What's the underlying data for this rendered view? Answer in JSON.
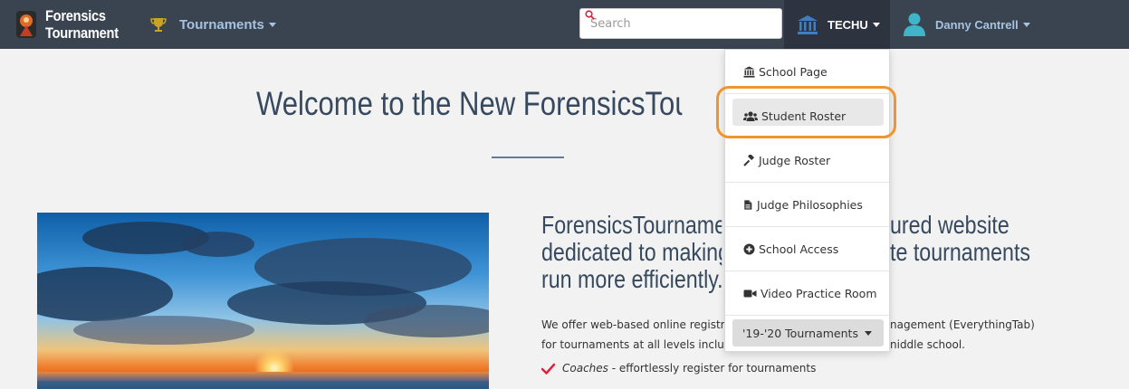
{
  "navbar": {
    "brand_line1": "Forensics",
    "brand_line2": "Tournament",
    "tournaments_label": "Tournaments",
    "search_placeholder": "Search",
    "school_label": "TECHU",
    "user_label": "Danny Cantrell"
  },
  "main": {
    "welcome": "Welcome to the New ForensicsTournament",
    "headline_left": [
      "ForensicsTournamen",
      "dedicated to making",
      "run more efficiently."
    ],
    "headline_right": [
      "ured website",
      "te tournaments"
    ],
    "body_left": [
      "We offer web-based online registr",
      "for tournaments at all levels inclu"
    ],
    "body_right": [
      "nagement (EverythingTab)",
      "niddle school."
    ],
    "coaches_label": "Coaches",
    "coaches_text": " - effortlessly register for tournaments"
  },
  "dropdown": {
    "items": [
      {
        "label": "School Page",
        "icon": "bank-icon"
      },
      {
        "label": "Student Roster",
        "icon": "users-icon"
      },
      {
        "label": "Judge Roster",
        "icon": "gavel-icon"
      },
      {
        "label": "Judge Philosophies",
        "icon": "file-icon"
      },
      {
        "label": "School Access",
        "icon": "plus-circle-icon"
      },
      {
        "label": "Video Practice Room",
        "icon": "video-icon"
      }
    ],
    "season_select": "'19-'20 Tournaments"
  },
  "colors": {
    "navbar": "#3a4350",
    "accent_link": "#a8c3df",
    "highlight": "#f0952e",
    "heading": "#36495e"
  }
}
